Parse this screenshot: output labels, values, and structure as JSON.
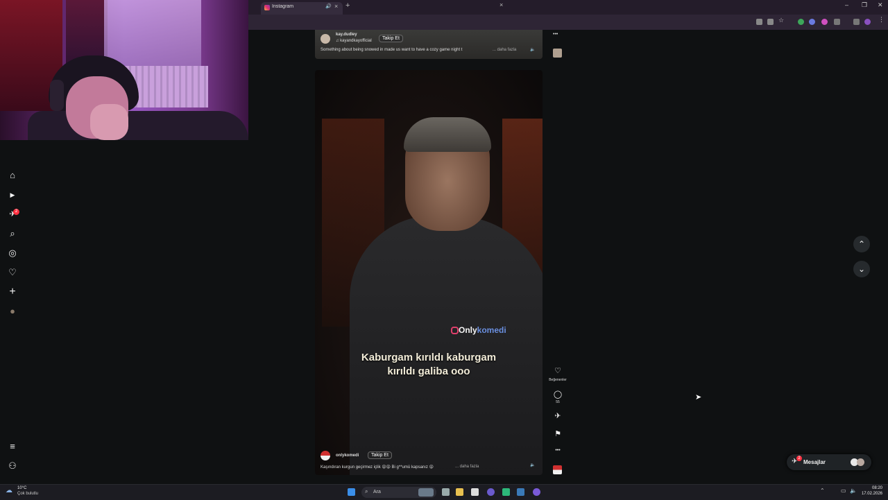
{
  "browser": {
    "tab_title": "Instagram",
    "tab_audio_icon": "speaker-icon",
    "new_tab_symbol": "+",
    "close_symbol": "×",
    "window_controls": [
      "–",
      "❐",
      "✕"
    ]
  },
  "sidebar": {
    "items": [
      {
        "name": "home",
        "glyph": "⌂"
      },
      {
        "name": "reels",
        "glyph": "▶"
      },
      {
        "name": "messages",
        "glyph": "✈",
        "badge": "2"
      },
      {
        "name": "search",
        "glyph": "⌕"
      },
      {
        "name": "explore",
        "glyph": "◎"
      },
      {
        "name": "notifications",
        "glyph": "♡"
      },
      {
        "name": "create",
        "glyph": "+"
      },
      {
        "name": "profile",
        "glyph": "●"
      }
    ],
    "more_glyph": "≡",
    "meta_glyph": "⚇"
  },
  "post_top": {
    "username": "kay.dudley",
    "audio": "kayandkayofficial",
    "follow_label": "Takip Et",
    "caption": "Something about being snowed in made us want to have a cozy game night t",
    "more_label": "... daha fazla",
    "options_glyph": "•••"
  },
  "reel": {
    "watermark_prefix": "Only",
    "watermark_suffix": "komedi",
    "subtitle_line1": "Kaburgam kırıldı kaburgam",
    "subtitle_line2": "kırıldı galiba ooo",
    "username": "onlykomedi",
    "follow_label": "Takip Et",
    "caption": "Kaşındıran kurgun geçirmez içlik 😝😝 Bi g**umü kapsanız 😝",
    "more_label": "... daha fazla"
  },
  "rail": {
    "like_glyph": "♡",
    "like_label": "Beğenenler",
    "comment_glyph": "◯",
    "comment_count": "55",
    "share_glyph": "✈",
    "save_glyph": "⚑",
    "options_glyph": "•••"
  },
  "nav_buttons": {
    "up": "⌃",
    "down": "⌄"
  },
  "messages_pill": {
    "label": "Mesajlar",
    "badge": "2"
  },
  "taskbar": {
    "weather_temp": "10°C",
    "weather_desc": "Çok bulutlu",
    "search_placeholder": "Ara",
    "time": "08:20",
    "date": "17.02.2026"
  }
}
